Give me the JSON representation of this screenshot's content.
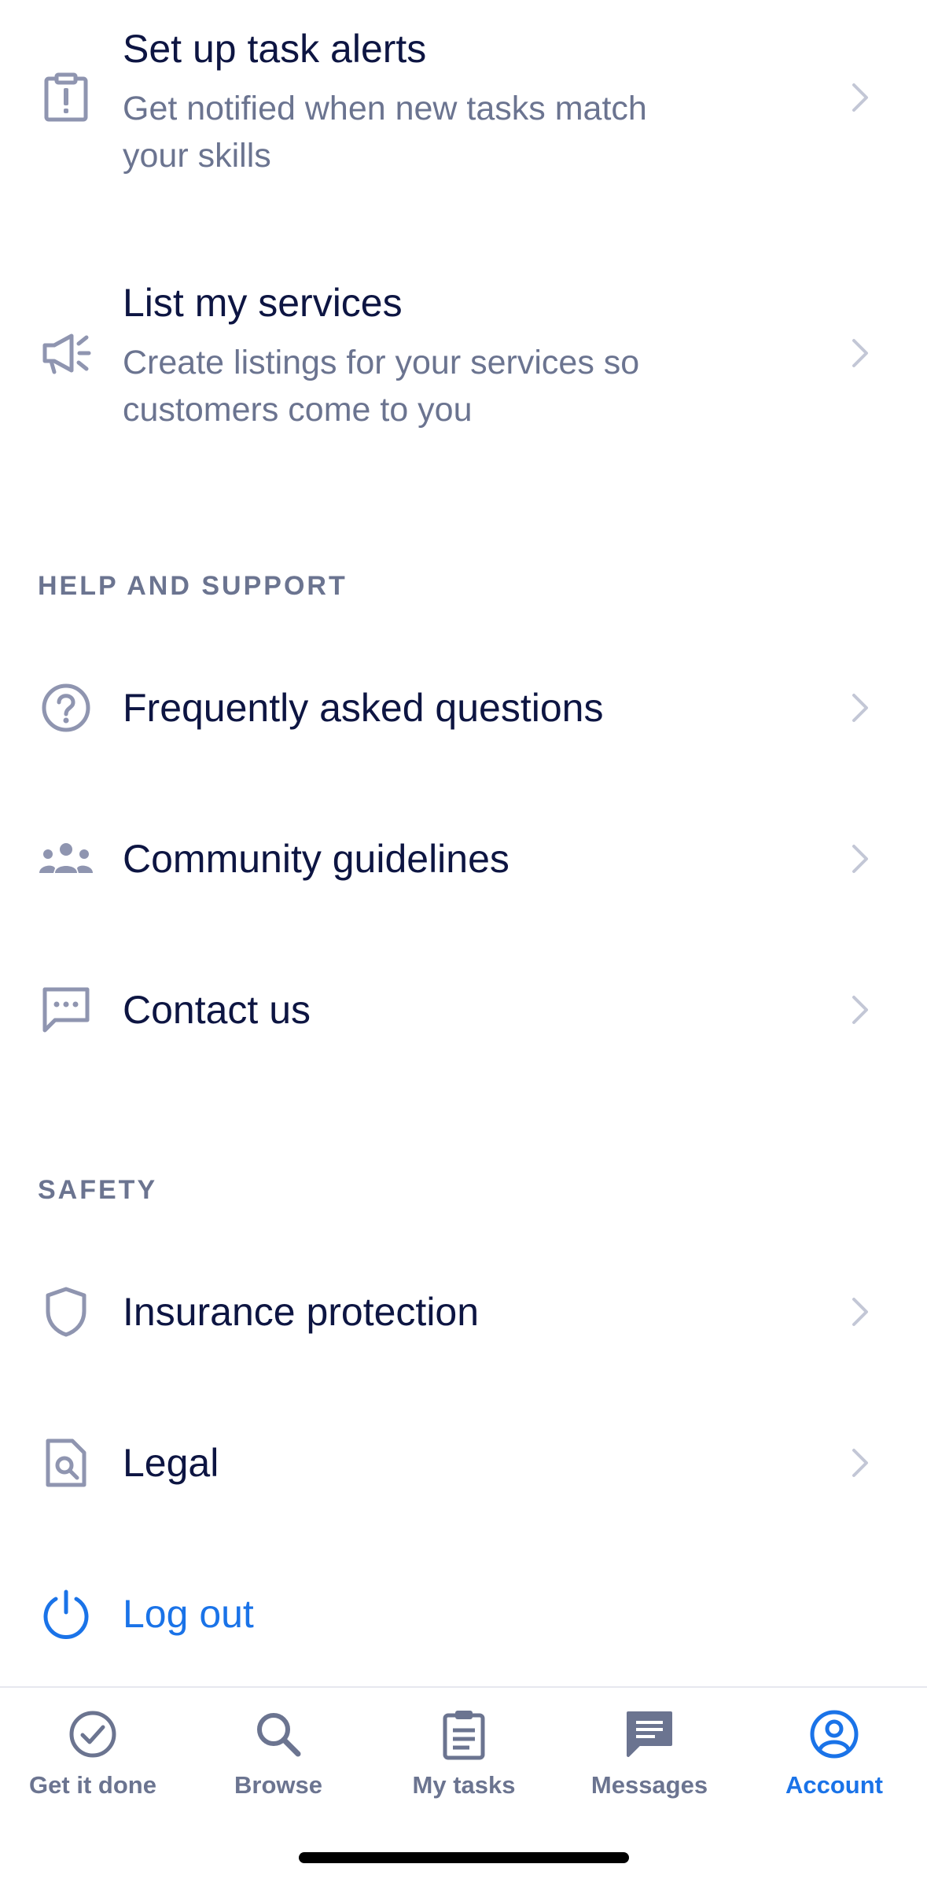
{
  "colors": {
    "title": "#0d1542",
    "subtitle": "#6b7490",
    "icon": "#8f95b0",
    "accent": "#1a73e8"
  },
  "items_top": [
    {
      "icon": "alert-clipboard-icon",
      "title": "Set up task alerts",
      "subtitle": "Get notified when new tasks match your skills"
    },
    {
      "icon": "megaphone-icon",
      "title": "List my services",
      "subtitle": "Create listings for your services so customers come to you"
    }
  ],
  "help_support": {
    "header": "HELP AND SUPPORT",
    "items": [
      {
        "icon": "question-circle-icon",
        "title": "Frequently asked questions"
      },
      {
        "icon": "community-icon",
        "title": "Community guidelines"
      },
      {
        "icon": "chat-bubble-icon",
        "title": "Contact us"
      }
    ]
  },
  "safety": {
    "header": "SAFETY",
    "items": [
      {
        "icon": "shield-icon",
        "title": "Insurance protection"
      },
      {
        "icon": "document-search-icon",
        "title": "Legal"
      }
    ]
  },
  "logout": {
    "icon": "power-icon",
    "label": "Log out"
  },
  "tabbar": {
    "active": "Account",
    "tabs": [
      {
        "icon": "check-circle-icon",
        "label": "Get it done"
      },
      {
        "icon": "search-icon",
        "label": "Browse"
      },
      {
        "icon": "clipboard-icon",
        "label": "My tasks"
      },
      {
        "icon": "message-icon",
        "label": "Messages"
      },
      {
        "icon": "account-icon",
        "label": "Account"
      }
    ]
  }
}
